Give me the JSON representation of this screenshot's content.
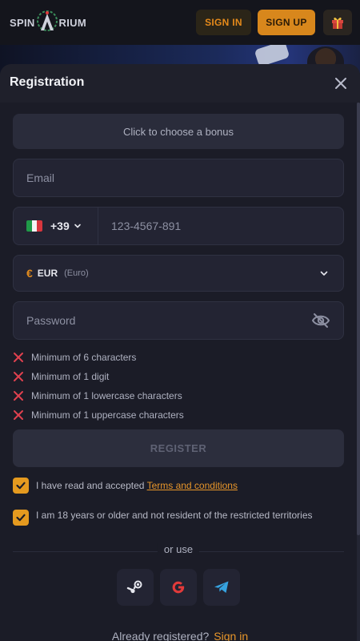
{
  "header": {
    "logo_left": "SPIN",
    "logo_right": "RIUM",
    "sign_in_label": "SIGN IN",
    "sign_up_label": "SIGN UP"
  },
  "modal": {
    "title": "Registration",
    "bonus_label": "Click to choose a bonus",
    "email_placeholder": "Email",
    "phone": {
      "country_code": "+39",
      "placeholder": "123-4567-891"
    },
    "currency": {
      "symbol": "€",
      "code": "EUR",
      "name": "(Euro)"
    },
    "password_placeholder": "Password",
    "password_rules": [
      "Minimum of 6 characters",
      "Minimum of 1 digit",
      "Minimum of 1 lowercase characters",
      "Minimum of 1 uppercase characters"
    ],
    "register_label": "REGISTER",
    "terms_prefix": "I have read and accepted ",
    "terms_link": "Terms and conditions",
    "age_text": "I am 18 years or older and not resident of the restricted territories",
    "or_use": "or use",
    "already_text": "Already registered?",
    "sign_in_link": "Sign in"
  },
  "colors": {
    "accent": "#e59a1f",
    "error": "#e0414f",
    "background": "#1b1c27"
  },
  "icons": [
    "gift-icon",
    "close-icon",
    "chevron-down-icon",
    "eye-off-icon",
    "x-mark-icon",
    "check-icon",
    "steam-icon",
    "google-icon",
    "telegram-icon"
  ]
}
